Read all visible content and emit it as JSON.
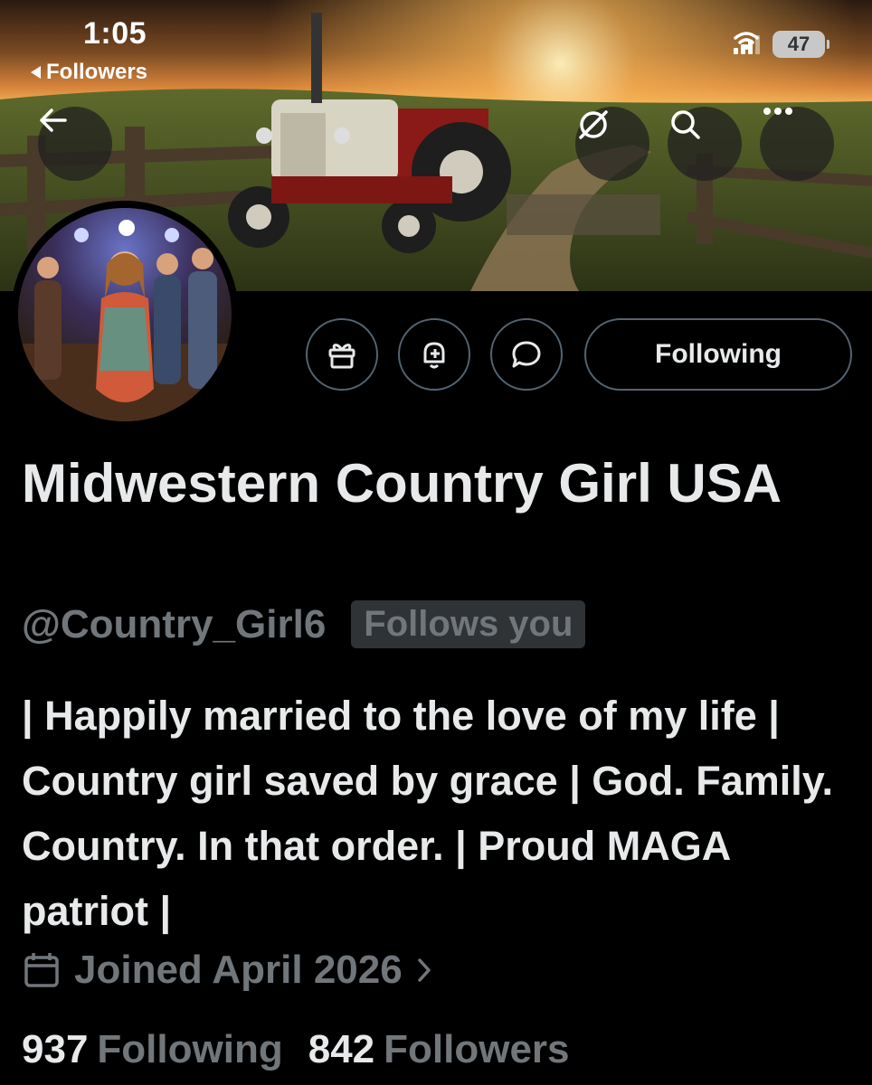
{
  "status_bar": {
    "time": "1:05",
    "back_label": "Followers",
    "battery": "47",
    "icons": [
      "signal-icon",
      "wifi-icon",
      "battery-icon"
    ]
  },
  "header": {
    "icons": [
      "back-arrow-icon",
      "grok-icon",
      "search-icon",
      "more-icon"
    ]
  },
  "profile": {
    "display_name": "Midwestern Country Girl USA",
    "handle": "@Country_Girl6",
    "follows_you": "Follows you",
    "bio": "| Happily married to the love of my life | Country girl saved by grace | God. Family. Country. In that order. | Proud MAGA patriot |",
    "joined": "Joined April 2026",
    "following_count": "937",
    "following_label": "Following",
    "followers_count": "842",
    "followers_label": "Followers"
  },
  "actions": {
    "icons": [
      "gift-icon",
      "bell-plus-icon",
      "message-icon"
    ],
    "follow_state": "Following"
  },
  "colors": {
    "background": "#000000",
    "text": "#e7e9ea",
    "secondary": "#71767b",
    "border": "#536471",
    "badge_bg": "#2f3336"
  }
}
